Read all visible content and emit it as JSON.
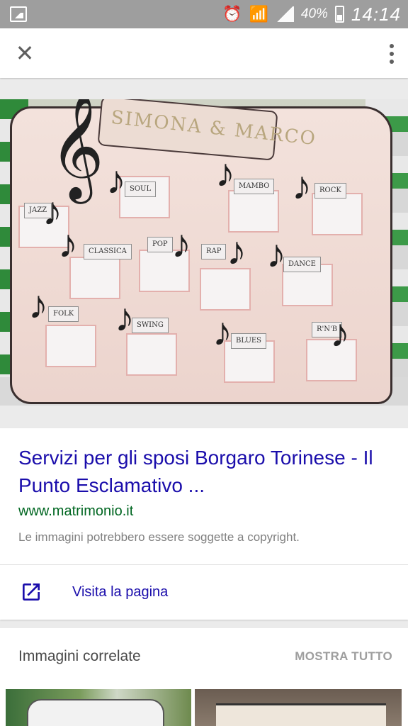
{
  "status_bar": {
    "battery_percent": "40%",
    "time": "14:14",
    "icons": [
      "image-icon",
      "alarm-icon",
      "wifi-icon",
      "signal-icon",
      "battery-icon"
    ]
  },
  "app_bar": {
    "close_icon": "close-icon",
    "menu_icon": "more-vert-icon"
  },
  "photo": {
    "banner_text": "SIMONA & MARCO",
    "tags": [
      "JAZZ",
      "SOUL",
      "MAMBO",
      "ROCK",
      "CLASSICA",
      "POP",
      "RAP",
      "DANCE",
      "FOLK",
      "SWING",
      "BLUES",
      "R'N'B"
    ]
  },
  "result": {
    "title": "Servizi per gli sposi Borgaro Torinese - Il Punto Esclamativo ...",
    "url": "www.matrimonio.it",
    "copyright_note": "Le immagini potrebbero essere soggette a copyright.",
    "visit_label": "Visita la pagina",
    "visit_icon": "open-in-new-icon"
  },
  "related": {
    "title": "Immagini correlate",
    "show_all": "MOSTRA TUTTO"
  },
  "colors": {
    "link": "#1a0dab",
    "url": "#006621",
    "status_bar": "#9e9e9e"
  }
}
